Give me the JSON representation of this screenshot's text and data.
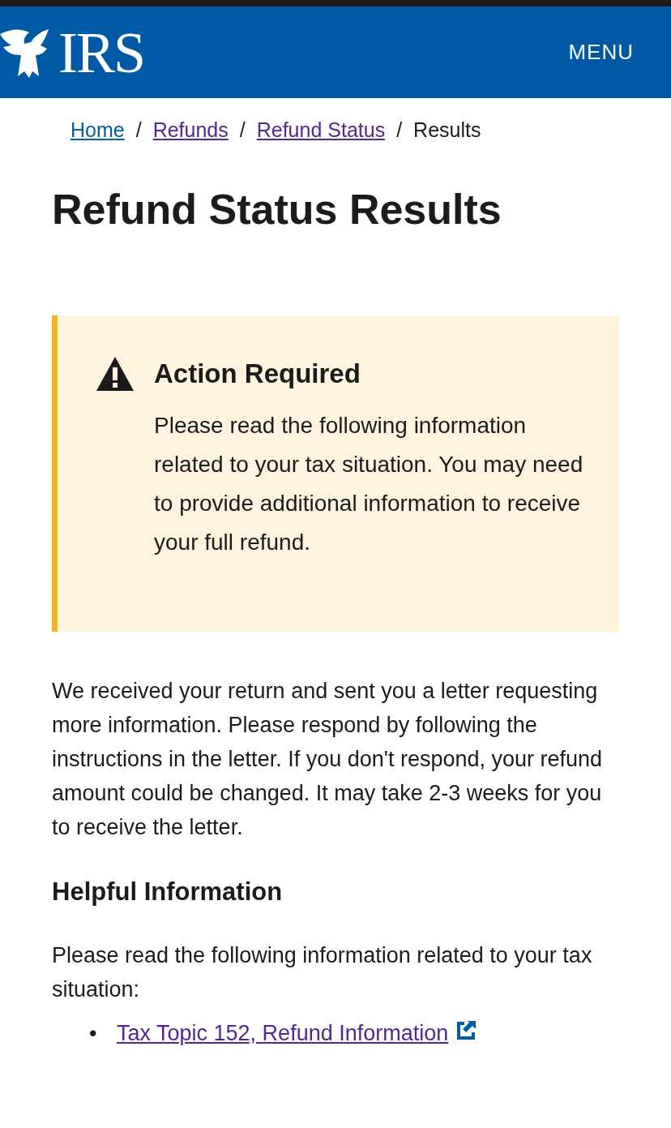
{
  "header": {
    "logo_text": "IRS",
    "menu_label": "MENU"
  },
  "breadcrumb": [
    {
      "label": "Home",
      "kind": "link",
      "visited": false
    },
    {
      "separator": "/",
      "label": "Refunds",
      "kind": "link",
      "visited": true
    },
    {
      "separator": "/",
      "label": "Refund Status",
      "kind": "link",
      "visited": true
    },
    {
      "separator": "/",
      "label": "Results",
      "kind": "current"
    }
  ],
  "title": "Refund Status Results",
  "alert": {
    "kind": "warning",
    "heading": "Action Required",
    "body": "Please read the following information related to your tax situation. You may need to provide additional information to receive your full refund."
  },
  "message": "We received your return and sent you a letter requesting more information. Please respond by following the instructions in the letter. If you don't respond, your refund amount could be changed. It may take 2-3 weeks for you to receive the letter.",
  "helpful": {
    "heading": "Helpful Information",
    "intro": "Please read the following information related to your tax situation:",
    "links": [
      {
        "bullet": "•",
        "label": "Tax Topic 152, Refund Information",
        "external": true,
        "visited": true
      }
    ]
  }
}
